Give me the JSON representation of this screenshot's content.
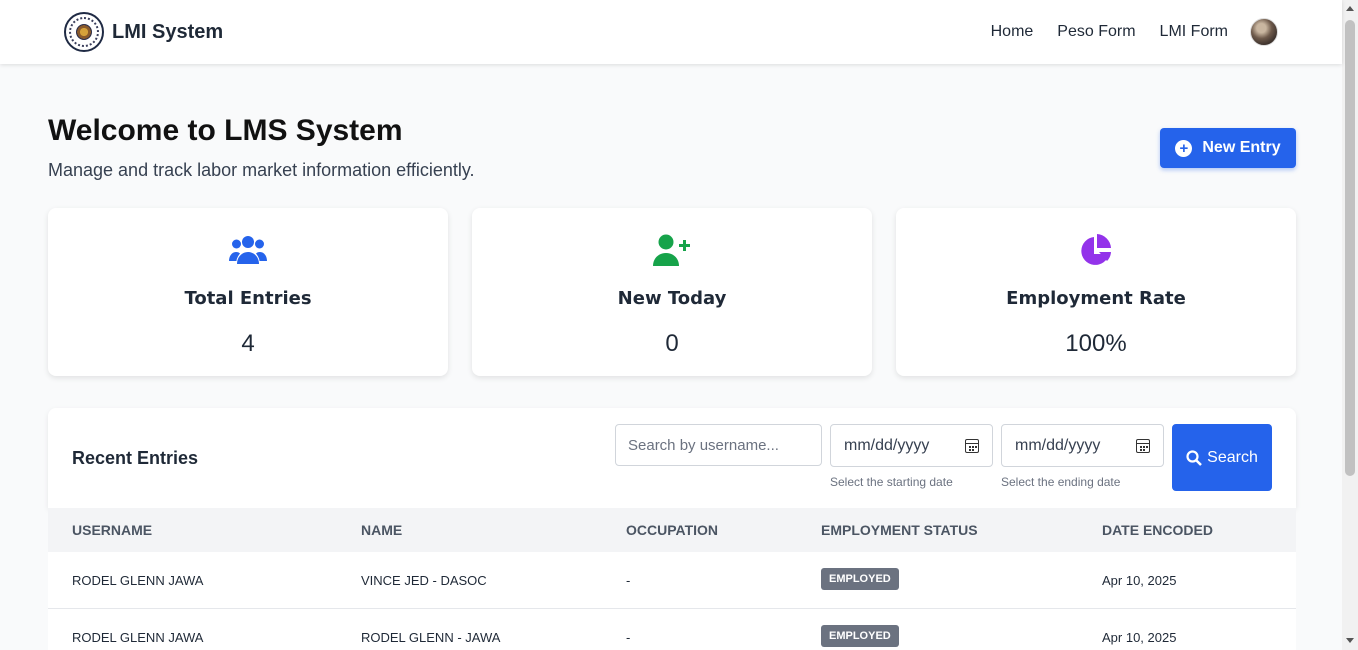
{
  "nav": {
    "brand": "LMI System",
    "links": [
      "Home",
      "Peso Form",
      "LMI Form"
    ]
  },
  "hero": {
    "title": "Welcome to LMS System",
    "subtitle": "Manage and track labor market information efficiently.",
    "new_entry_label": "New Entry"
  },
  "cards": [
    {
      "label": "Total Entries",
      "value": "4",
      "icon": "users-icon",
      "color": "#2563eb"
    },
    {
      "label": "New Today",
      "value": "0",
      "icon": "user-plus-icon",
      "color": "#16a34a"
    },
    {
      "label": "Employment Rate",
      "value": "100%",
      "icon": "pie-chart-icon",
      "color": "#9333ea"
    }
  ],
  "recent": {
    "title": "Recent Entries",
    "search_placeholder": "Search by username...",
    "date_placeholder": "mm/dd/yyyy",
    "start_help": "Select the starting date",
    "end_help": "Select the ending date",
    "search_label": "Search"
  },
  "table": {
    "headers": [
      "USERNAME",
      "NAME",
      "OCCUPATION",
      "EMPLOYMENT STATUS",
      "DATE ENCODED"
    ],
    "rows": [
      {
        "username": "RODEL GLENN JAWA",
        "name": "VINCE JED - DASOC",
        "occupation": "-",
        "status": "EMPLOYED",
        "date": "Apr 10, 2025"
      },
      {
        "username": "RODEL GLENN JAWA",
        "name": "RODEL GLENN - JAWA",
        "occupation": "-",
        "status": "EMPLOYED",
        "date": "Apr 10, 2025"
      }
    ]
  },
  "colors": {
    "primary": "#2563eb",
    "badge": "#6b7280"
  }
}
